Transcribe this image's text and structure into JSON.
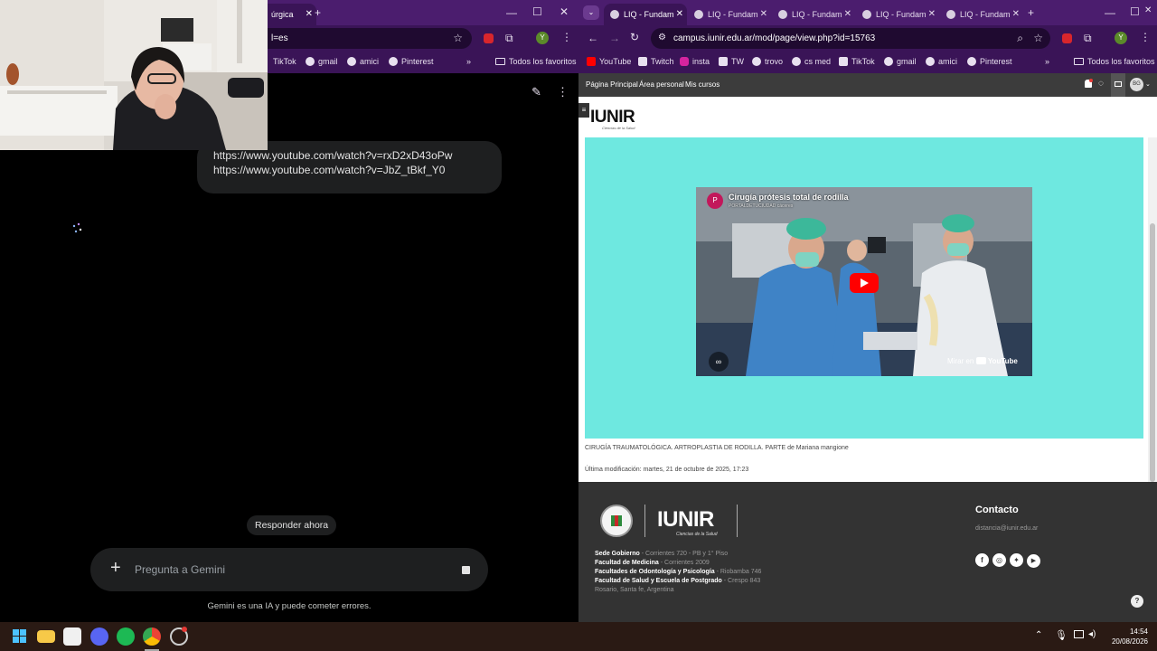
{
  "left_browser": {
    "tab_fragment": "úrgica",
    "url_fragment": "l=es",
    "bookmarks": [
      "TikTok",
      "gmail",
      "amici",
      "Pinterest"
    ],
    "favorites_folder": "Todos los favoritos",
    "profile_letter": "Y"
  },
  "gemini": {
    "user_message_lines": [
      "https://www.youtube.com/watch?v=rxD2xD43oPw",
      "https://www.youtube.com/watch?v=JbZ_tBkf_Y0"
    ],
    "respond_now": "Responder ahora",
    "prompt_placeholder": "Pregunta a Gemini",
    "disclaimer": "Gemini es una IA y puede cometer errores."
  },
  "right_browser": {
    "tabs": [
      {
        "label": "LIQ - Fundam",
        "active": true
      },
      {
        "label": "LIQ - Fundam",
        "active": false
      },
      {
        "label": "LIQ - Fundam",
        "active": false
      },
      {
        "label": "LIQ - Fundam",
        "active": false
      },
      {
        "label": "LIQ - Fundam",
        "active": false
      }
    ],
    "url": "campus.iunir.edu.ar/mod/page/view.php?id=15763",
    "bookmarks": [
      "YouTube",
      "Twitch",
      "insta",
      "TW",
      "trovo",
      "cs med",
      "TikTok",
      "gmail",
      "amici",
      "Pinterest"
    ],
    "favorites_folder": "Todos los favoritos",
    "profile_letter": "Y"
  },
  "moodle": {
    "nav": [
      "Página Principal",
      "Área personal",
      "Mis cursos"
    ],
    "user_initials": "BG",
    "logo_text": "IUNIR",
    "logo_sub": "Ciencias de la Salud",
    "video": {
      "channel_letter": "P",
      "title": "Cirugía prótesis total de rodilla",
      "channel": "PORTALDETUCIUDAD cáceres",
      "watch_on": "Mirar en",
      "youtube": "YouTube"
    },
    "caption_main": "CIRUGÍA TRAUMATOLÓGICA. ARTROPLASTIA DE RODILLA. PARTE",
    "caption_author": "de Mariana mangione",
    "last_modified": "Última modificación: martes, 21 de octubre de 2025, 17:23",
    "footer": {
      "logo_text": "IUNIR",
      "logo_sub": "Ciencias de la Salud",
      "addresses": [
        {
          "name": "Sede Gobierno",
          "addr": " - Corrientes 720 - PB y 1° Piso"
        },
        {
          "name": "Facultad de Medicina",
          "addr": " - Corrientes 2009"
        },
        {
          "name": "Facultades de Odontología y Psicología",
          "addr": " - Riobamba 746"
        },
        {
          "name": "Facultad de Salud y Escuela de Postgrado",
          "addr": " - Crespo 843"
        }
      ],
      "city": "Rosario, Santa fe, Argentina",
      "contact_title": "Contacto",
      "contact_email": "distancia@iunir.edu.ar"
    }
  },
  "taskbar": {
    "time": "14:54",
    "date": "20/08/2026"
  },
  "colors": {
    "browser_purple": "#4b1d6e",
    "video_bg": "#6ee8e0",
    "youtube_red": "#ff0000",
    "footer_bg": "#333333"
  }
}
